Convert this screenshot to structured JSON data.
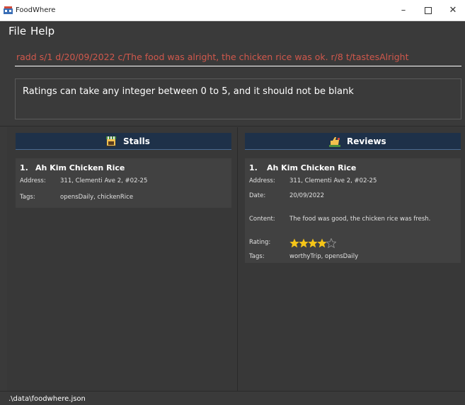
{
  "window": {
    "title": "FoodWhere",
    "minimize_glyph": "–",
    "close_glyph": "✕"
  },
  "menu": {
    "file": "File",
    "help": "Help"
  },
  "command": {
    "value": "radd s/1 d/20/09/2022 c/The food was alright, the chicken rice was ok. r/8 t/tastesAlright",
    "text_color": "#d0584c"
  },
  "result": {
    "message": "Ratings can take any integer between 0 to 5, and it should not be blank"
  },
  "stalls": {
    "header": "Stalls",
    "header_icon": "food-stall-icon",
    "items": [
      {
        "index": "1.",
        "name": "Ah Kim Chicken Rice",
        "address_label": "Address:",
        "address": "311, Clementi Ave 2, #02-25",
        "tags_label": "Tags:",
        "tags": "opensDaily, chickenRice"
      }
    ]
  },
  "reviews": {
    "header": "Reviews",
    "header_icon": "thumbs-up-icon",
    "items": [
      {
        "index": "1.",
        "name": "Ah Kim Chicken Rice",
        "address_label": "Address:",
        "address": "311, Clementi Ave 2, #02-25",
        "date_label": "Date:",
        "date": "20/09/2022",
        "content_label": "Content:",
        "content": "The food was good, the chicken rice was fresh.",
        "rating_label": "Rating:",
        "rating": 4,
        "rating_max": 5,
        "tags_label": "Tags:",
        "tags": "worthyTrip, opensDaily"
      }
    ]
  },
  "status": {
    "path": ".\\data\\foodwhere.json"
  },
  "colors": {
    "background": "#3a3a3a",
    "header_bg": "#1e3149",
    "star": "#f5c518",
    "star_empty": "#8a8a8a"
  }
}
